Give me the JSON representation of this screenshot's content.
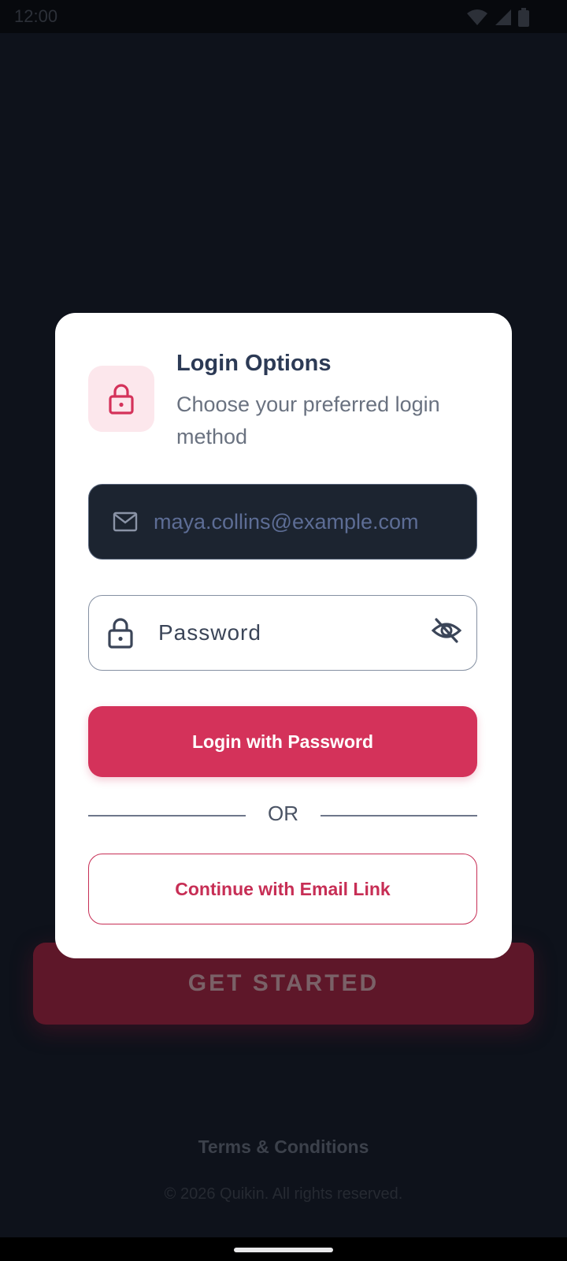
{
  "status_bar": {
    "time": "12:00",
    "icons": [
      "wifi-icon",
      "signal-icon",
      "battery-icon"
    ]
  },
  "background": {
    "get_started_label": "GET STARTED",
    "terms_label": "Terms & Conditions",
    "copyright": "© 2026 Quikin. All rights reserved."
  },
  "dialog": {
    "title": "Login Options",
    "subtitle": "Choose your preferred login method",
    "header_icon": "lock-icon",
    "email_field": {
      "icon": "mail-icon",
      "value": "maya.collins@example.com"
    },
    "password_field": {
      "icon": "lock-icon",
      "placeholder": "Password",
      "toggle_icon": "eye-off-icon"
    },
    "login_button_label": "Login with Password",
    "divider_label": "OR",
    "email_link_button_label": "Continue with Email Link"
  },
  "colors": {
    "accent": "#d4325a",
    "accent_outline": "#c72e55",
    "overlay_background": "#0e121b",
    "dialog_background": "#ffffff",
    "title": "#2c3a55"
  }
}
